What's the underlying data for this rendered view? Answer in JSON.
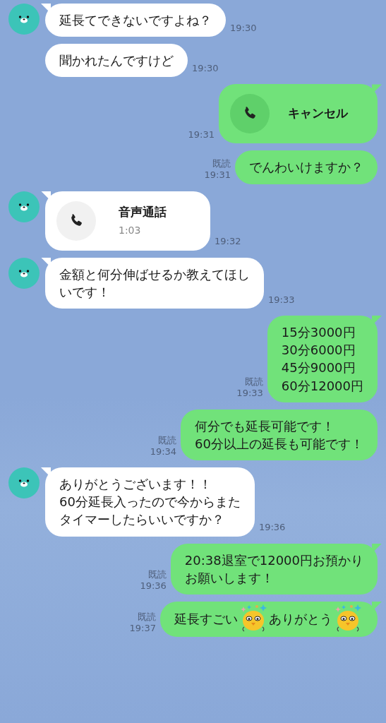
{
  "messages": [
    {
      "outgoing": false,
      "kind": "text",
      "avatar": true,
      "tail": true,
      "lines": [
        "延長てできないですよね？"
      ],
      "time": "19:30"
    },
    {
      "outgoing": false,
      "kind": "text",
      "avatar": false,
      "tail": false,
      "lines": [
        "聞かれたんですけど"
      ],
      "time": "19:30"
    },
    {
      "outgoing": true,
      "kind": "call",
      "tail": true,
      "title": "キャンセル",
      "time": "19:31"
    },
    {
      "outgoing": true,
      "kind": "text",
      "tail": false,
      "read": "既読",
      "lines": [
        "でんわいけますか？"
      ],
      "time": "19:31"
    },
    {
      "outgoing": false,
      "kind": "call",
      "avatar": true,
      "tail": true,
      "title": "音声通話",
      "duration": "1:03",
      "time": "19:32"
    },
    {
      "outgoing": false,
      "kind": "text",
      "avatar": true,
      "tail": true,
      "lines": [
        "金額と何分伸ばせるか教えてほし",
        "いです！"
      ],
      "time": "19:33"
    },
    {
      "outgoing": true,
      "kind": "text",
      "tail": true,
      "read": "既読",
      "lines": [
        "15分3000円",
        "30分6000円",
        "45分9000円",
        "60分12000円"
      ],
      "time": "19:33"
    },
    {
      "outgoing": true,
      "kind": "text",
      "tail": false,
      "read": "既読",
      "lines": [
        "何分でも延長可能です！",
        "60分以上の延長も可能です！"
      ],
      "time": "19:34"
    },
    {
      "outgoing": false,
      "kind": "text",
      "avatar": true,
      "tail": true,
      "lines": [
        "ありがとうございます！！",
        "60分延長入ったので今からまた",
        "タイマーしたらいいですか？"
      ],
      "time": "19:36"
    },
    {
      "outgoing": true,
      "kind": "text",
      "tail": true,
      "read": "既読",
      "lines": [
        "20:38退室で12000円お預かり",
        "お願いします！"
      ],
      "time": "19:36"
    },
    {
      "outgoing": true,
      "kind": "emoji_text",
      "tail": true,
      "read": "既読",
      "parts": [
        {
          "kind": "text",
          "text": "延長すごい"
        },
        {
          "kind": "emoji"
        },
        {
          "kind": "text",
          "text": "ありがとう"
        },
        {
          "kind": "emoji"
        }
      ],
      "time": "19:37"
    }
  ]
}
